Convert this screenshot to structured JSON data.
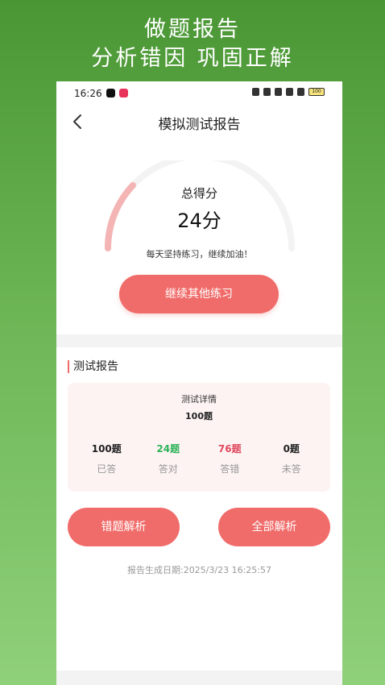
{
  "promo": {
    "line1": "做题报告",
    "line2": "分析错因  巩固正解"
  },
  "statusbar": {
    "time": "16:26",
    "battery": "100"
  },
  "nav": {
    "title": "模拟测试报告"
  },
  "score": {
    "title": "总得分",
    "value": "24分",
    "message": "每天坚持练习，继续加油！",
    "fraction": 0.24
  },
  "buttons": {
    "continue": "继续其他练习",
    "wrong_analysis": "错题解析",
    "all_analysis": "全部解析"
  },
  "report": {
    "section_title": "测试报告",
    "card_title": "测试详情",
    "total": "100题",
    "stats": [
      {
        "value": "100题",
        "label": "已答",
        "color": "#222222"
      },
      {
        "value": "24题",
        "label": "答对",
        "color": "#2fb35a"
      },
      {
        "value": "76题",
        "label": "答错",
        "color": "#e04a5f"
      },
      {
        "value": "0题",
        "label": "未答",
        "color": "#222222"
      }
    ],
    "date": "报告生成日期:2025/3/23 16:25:57"
  },
  "colors": {
    "accent": "#f06c6a",
    "correct": "#2fb35a",
    "wrong": "#e04a5f"
  }
}
